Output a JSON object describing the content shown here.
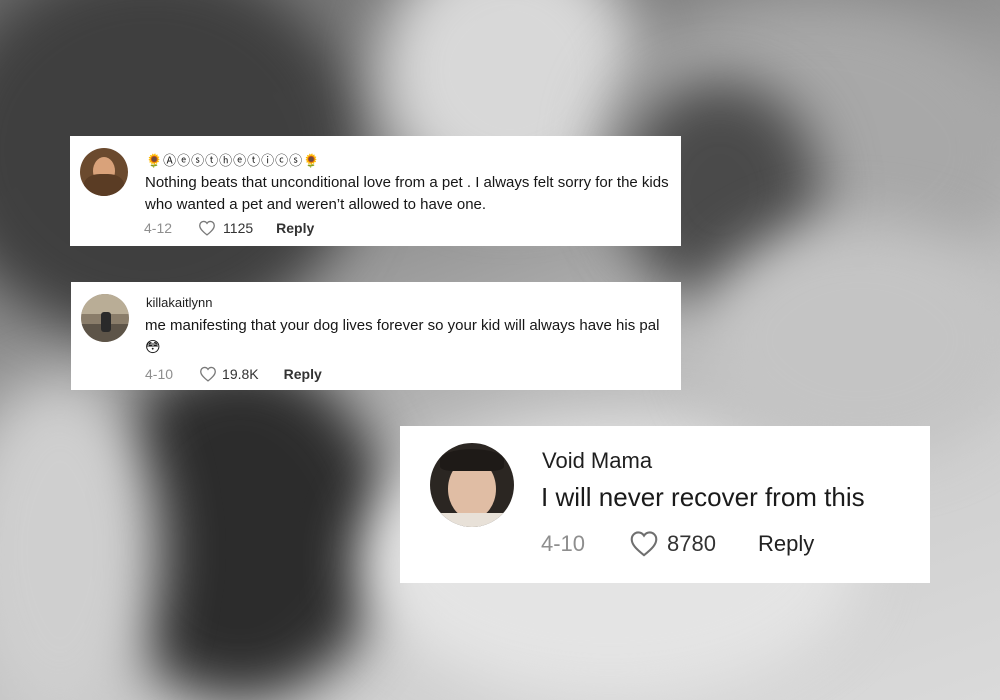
{
  "comments": [
    {
      "username": "🌻Ⓐⓔⓢⓣⓗⓔⓣⓘⓒⓢ🌻",
      "text": "Nothing beats that unconditional love from a pet . I always felt sorry for the kids who wanted a pet and weren’t allowed to have one.",
      "date": "4-12",
      "likes": "1125",
      "reply_label": "Reply"
    },
    {
      "username": "killakaitlynn",
      "text": "me manifesting that your dog lives forever so your kid will always have his pal 😳",
      "date": "4-10",
      "likes": "19.8K",
      "reply_label": "Reply"
    },
    {
      "username": "Void Mama",
      "text": "I will never recover from this",
      "date": "4-10",
      "likes": "8780",
      "reply_label": "Reply"
    }
  ],
  "colors": {
    "card_background": "#ffffff",
    "muted_text": "#8e8e8e",
    "primary_text": "#161616"
  },
  "icons": {
    "like": "heart-outline-icon"
  }
}
